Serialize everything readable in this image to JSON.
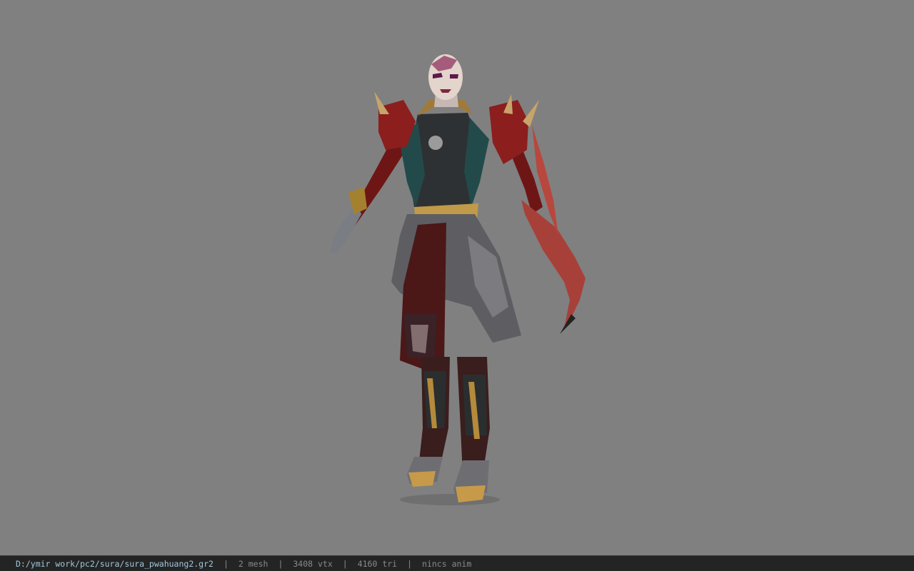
{
  "viewer": {
    "background_color": "#808080",
    "model_name": "sura_pwahuang2"
  },
  "statusbar": {
    "file_path": "D:/ymir work/pc2/sura/sura_pwahuang2.gr2",
    "separator": "|",
    "mesh_count": "2 mesh",
    "vertex_count": "3408 vtx",
    "triangle_count": "4160 tri",
    "animation": "nincs anim"
  },
  "colors": {
    "statusbar_bg": "#242424",
    "path_text": "#9fc8dc",
    "stat_text": "#8a8a8a"
  }
}
